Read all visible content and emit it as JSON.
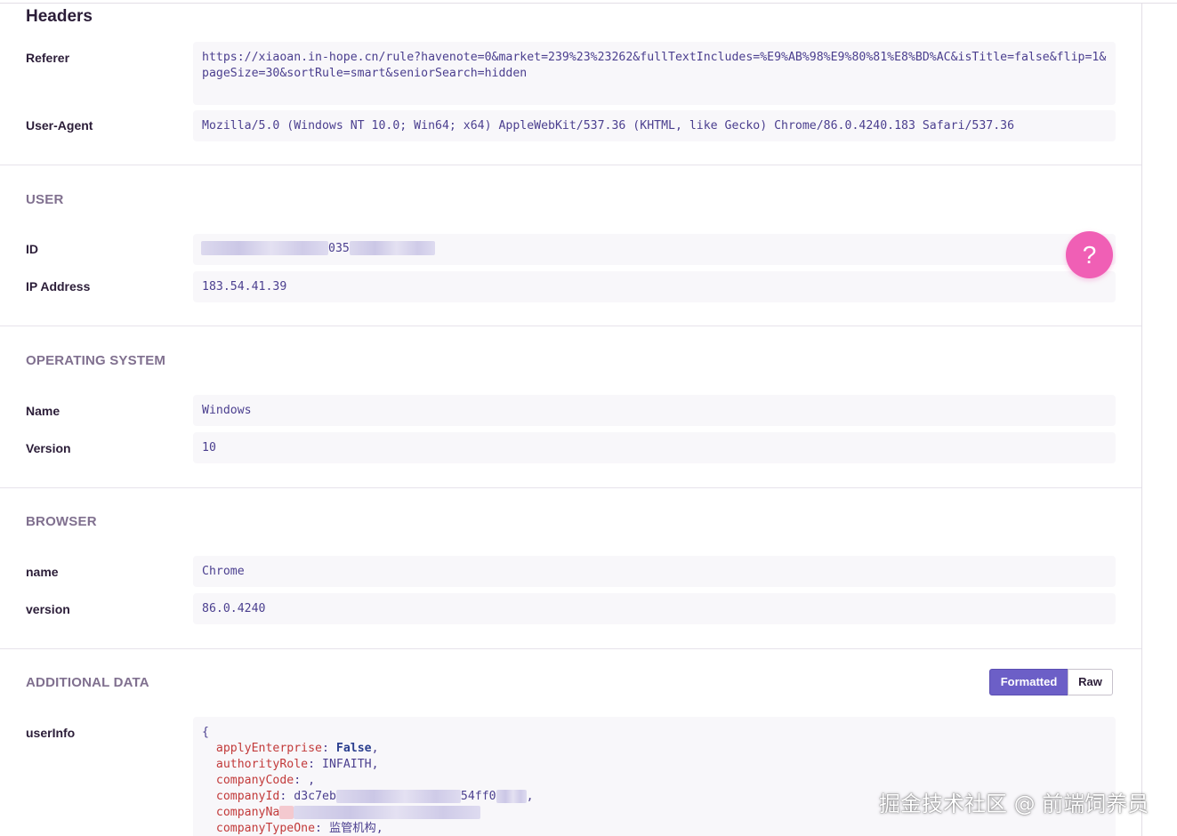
{
  "headers": {
    "title": "Headers",
    "referer_label": "Referer",
    "referer_value": "https://xiaoan.in-hope.cn/rule?havenote=0&market=239%23%23262&fullTextIncludes=%E9%AB%98%E9%80%81%E8%BD%AC&isTitle=false&flip=1&pageSize=30&sortRule=smart&seniorSearch=hidden",
    "ua_label": "User-Agent",
    "ua_value": "Mozilla/5.0 (Windows NT 10.0; Win64; x64) AppleWebKit/537.36 (KHTML, like Gecko) Chrome/86.0.4240.183 Safari/537.36"
  },
  "user": {
    "title": "USER",
    "id_label": "ID",
    "id_visible_fragment": "035",
    "ip_label": "IP Address",
    "ip_value": "183.54.41.39"
  },
  "os": {
    "title": "OPERATING SYSTEM",
    "name_label": "Name",
    "name_value": "Windows",
    "version_label": "Version",
    "version_value": "10"
  },
  "browser": {
    "title": "BROWSER",
    "name_label": "name",
    "name_value": "Chrome",
    "version_label": "version",
    "version_value": "86.0.4240"
  },
  "additional": {
    "title": "ADDITIONAL DATA",
    "formatted_label": "Formatted",
    "raw_label": "Raw",
    "userinfo_label": "userInfo",
    "open_brace": "{",
    "lines": [
      {
        "key": "applyEnterprise",
        "value": "False"
      },
      {
        "key": "authorityRole",
        "value": "INFAITH"
      },
      {
        "key": "companyCode",
        "value": ""
      },
      {
        "key": "companyId",
        "value": "d3c7eb",
        "tail": "54ff0"
      },
      {
        "key": "companyNa",
        "value": ""
      },
      {
        "key": "companyTypeOne",
        "value": "监管机构"
      }
    ]
  },
  "help_button": {
    "label": "?"
  },
  "watermark": "掘金技术社区 @ 前端饲养员",
  "colors": {
    "accent": "#6c5fc7",
    "help": "#f05fb5",
    "code_key": "#c23a3a",
    "code_value": "#4b3f8f"
  }
}
